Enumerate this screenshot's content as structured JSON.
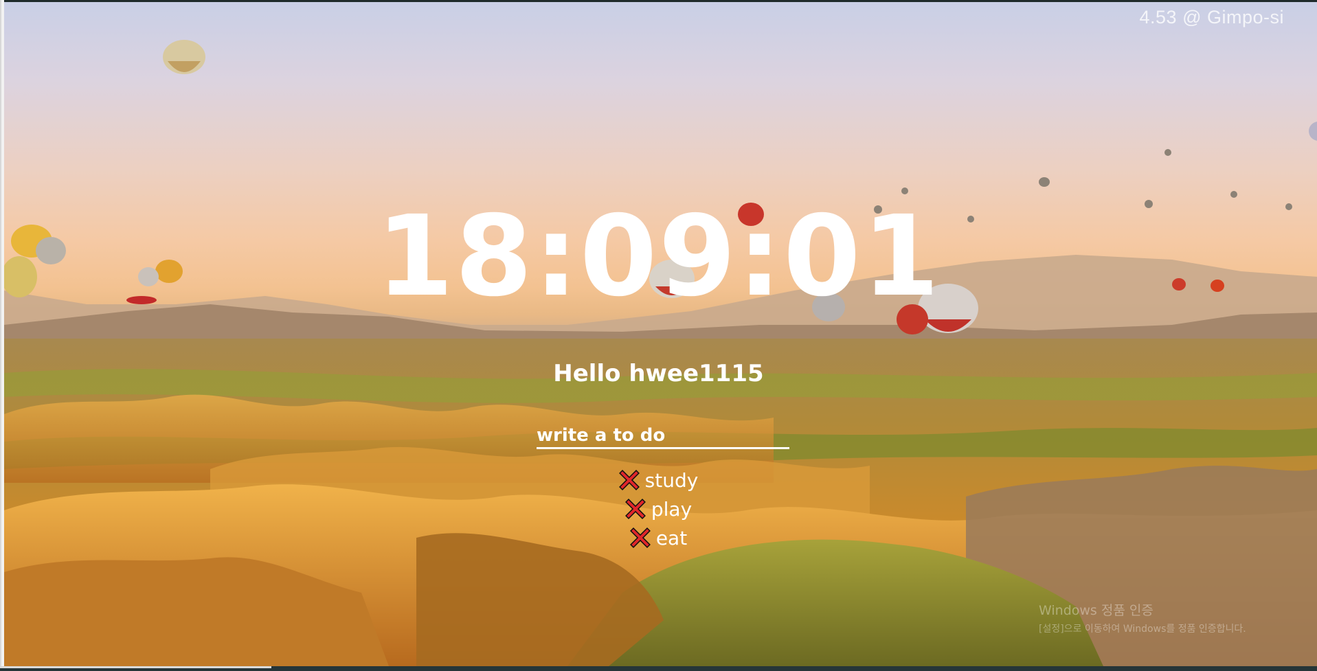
{
  "weather": {
    "temperature": "4.53",
    "separator": "@",
    "city": "Gimpo-si"
  },
  "clock": {
    "time": "18:09:01"
  },
  "greeting": {
    "text": "Hello hwee1115"
  },
  "todo": {
    "placeholder": "write a to do",
    "items": [
      {
        "label": "study"
      },
      {
        "label": "play"
      },
      {
        "label": "eat"
      }
    ]
  },
  "activation": {
    "title": "Windows 정품 인증",
    "subtitle": "[설정]으로 이동하여 Windows를 정품 인증합니다."
  },
  "colors": {
    "text": "#ffffff",
    "delete_icon": "#e0262b"
  },
  "icons": {
    "delete": "close-x-icon",
    "background": "hot-air-balloons-landscape"
  }
}
